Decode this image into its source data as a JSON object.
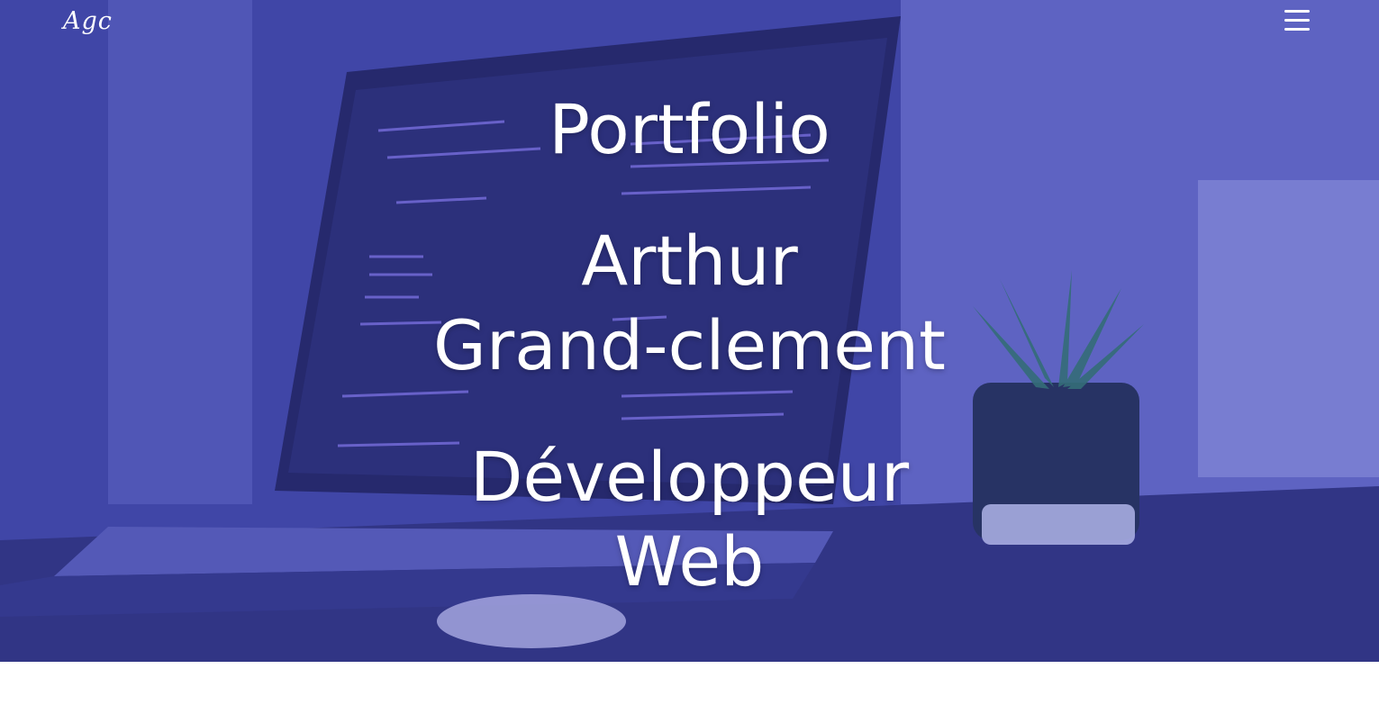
{
  "header": {
    "logo_text": "Agc",
    "menu_icon": "hamburger-menu-icon"
  },
  "hero": {
    "title": "Portfolio",
    "name_line1": "Arthur",
    "name_line2": "Grand-clement",
    "role_line1": "Développeur",
    "role_line2": "Web",
    "background_image": "laptop-with-code-and-plant-photo",
    "overlay_color": "#464ac8"
  }
}
